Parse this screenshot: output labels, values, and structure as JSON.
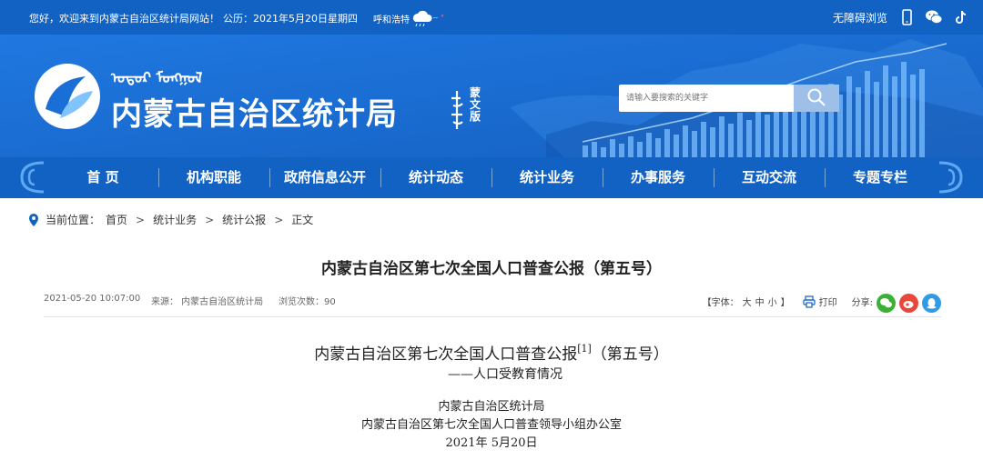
{
  "topbar": {
    "greeting": "您好，欢迎来到内蒙古自治区统计局网站！",
    "date": "公历：2021年5月20日星期四",
    "city": "呼和浩特",
    "weather_icon": "cloud-rain-icon",
    "accessibility": "无障碍浏览",
    "icons": [
      "mobile-icon",
      "wechat-icon",
      "tiktok-icon"
    ]
  },
  "header": {
    "site_title": "内蒙古自治区统计局",
    "mongolian_version_label": "蒙文版",
    "search_placeholder": "请输入要搜索的关键字",
    "colors": {
      "primary": "#1262c4",
      "banner": "#1a6fd6"
    }
  },
  "nav": {
    "items": [
      "首 页",
      "机构职能",
      "政府信息公开",
      "统计动态",
      "统计业务",
      "办事服务",
      "互动交流",
      "专题专栏"
    ]
  },
  "breadcrumb": {
    "label": "当前位置：",
    "items": [
      "首页",
      "统计业务",
      "统计公报",
      "正文"
    ],
    "separator": ">"
  },
  "article": {
    "title": "内蒙古自治区第七次全国人口普查公报（第五号）",
    "meta": {
      "datetime": "2021-05-20 10:07:00",
      "source": "来源： 内蒙古自治区统计局",
      "views": "浏览次数：90",
      "font_label": "【字体：",
      "font_large": "大",
      "font_medium": "中",
      "font_small": "小",
      "font_close": "】",
      "print": "打印",
      "share": "分享:"
    },
    "body": {
      "heading_main": "内蒙古自治区第七次全国人口普查公报",
      "footnote": "[1]",
      "heading_suffix": "（第五号）",
      "subheading": "——人口受教育情况",
      "org1": "内蒙古自治区统计局",
      "org2": "内蒙古自治区第七次全国人口普查领导小组办公室",
      "date": "2021年  5月20日"
    }
  }
}
